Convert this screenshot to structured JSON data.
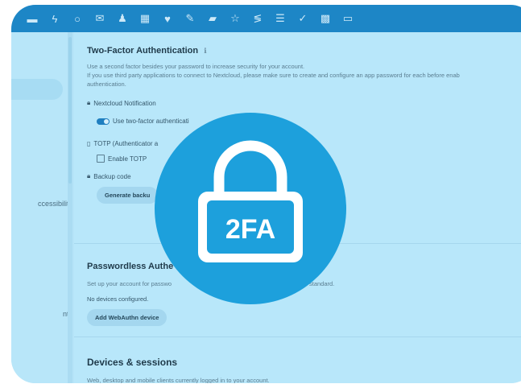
{
  "colors": {
    "accent": "#1da0dc",
    "topbar": "#1d86c6",
    "page_bg": "#b8e7fa"
  },
  "topbar": {
    "icons": [
      "folder-icon",
      "activity-icon",
      "circle-icon",
      "mail-icon",
      "contacts-icon",
      "calendar-icon",
      "heart-icon",
      "pencil-icon",
      "bag-icon",
      "star-icon",
      "deck-icon",
      "checklist-icon",
      "check-icon",
      "tables-icon",
      "menu-icon"
    ]
  },
  "sidebar": {
    "items": [
      {
        "label": ")"
      },
      {
        "label": "ccessibility"
      },
      {
        "label": "nts"
      }
    ]
  },
  "twofa": {
    "title": "Two-Factor Authentication",
    "info_glyph": "ℹ",
    "desc_line1": "Use a second factor besides your password to increase security for your account.",
    "desc_line2": "If you use third party applications to connect to Nextcloud, please make sure to create and configure an app password for each before enab",
    "desc_line3": "authentication.",
    "nextcloud_notification": "Nextcloud Notification",
    "use_two_factor": "Use two-factor authenticati",
    "totp": "TOTP (Authenticator a",
    "enable_totp": "Enable TOTP",
    "backup_code": "Backup code",
    "generate_button": "Generate backu"
  },
  "passwordless": {
    "title": "Passwordless Authe",
    "desc_left": "Set up your account for passwo",
    "desc_right": "standard.",
    "no_devices": "No devices configured.",
    "add_button": "Add WebAuthn device"
  },
  "sessions": {
    "title": "Devices & sessions",
    "desc": "Web, desktop and mobile clients currently logged in to your account."
  },
  "badge": {
    "label": "2FA"
  }
}
